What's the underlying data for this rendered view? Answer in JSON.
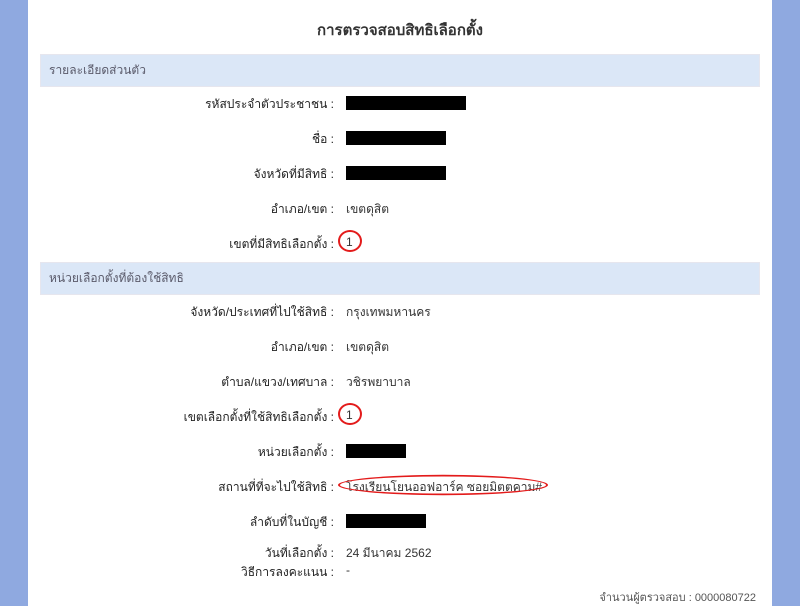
{
  "title": "การตรวจสอบสิทธิเลือกตั้ง",
  "section1": {
    "header": "รายละเอียดส่วนตัว",
    "rows": {
      "id_label": "รหัสประจำตัวประชาชน :",
      "name_label": "ชื่อ :",
      "province_label": "จังหวัดที่มีสิทธิ :",
      "district_label": "อำเภอ/เขต :",
      "district_value": "เขตดุสิต",
      "constituency_label": "เขตที่มีสิทธิเลือกตั้ง :",
      "constituency_value": "1"
    }
  },
  "section2": {
    "header": "หน่วยเลือกตั้งที่ต้องใช้สิทธิ",
    "rows": {
      "province2_label": "จังหวัด/ประเทศที่ไปใช้สิทธิ :",
      "province2_value": "กรุงเทพมหานคร",
      "district2_label": "อำเภอ/เขต :",
      "district2_value": "เขตดุสิต",
      "subdist_label": "ตำบล/แขวง/เทศบาล :",
      "subdist_value": "วชิรพยาบาล",
      "constituency2_label": "เขตเลือกตั้งที่ใช้สิทธิเลือกตั้ง :",
      "constituency2_value": "1",
      "unit_label": "หน่วยเลือกตั้ง :",
      "place_label": "สถานที่ที่จะไปใช้สิทธิ :",
      "place_value": "โรงเรียนโยนออฟอาร์ค ซอยมิตตคาม#",
      "order_label": "ลำดับที่ในบัญชี :",
      "date_label": "วันที่เลือกตั้ง :",
      "date_value": "24 มีนาคม 2562",
      "method_label": "วิธีการลงคะแนน :",
      "method_value": "-"
    }
  },
  "footer": "จำนวนผู้ตรวจสอบ : 0000080722"
}
